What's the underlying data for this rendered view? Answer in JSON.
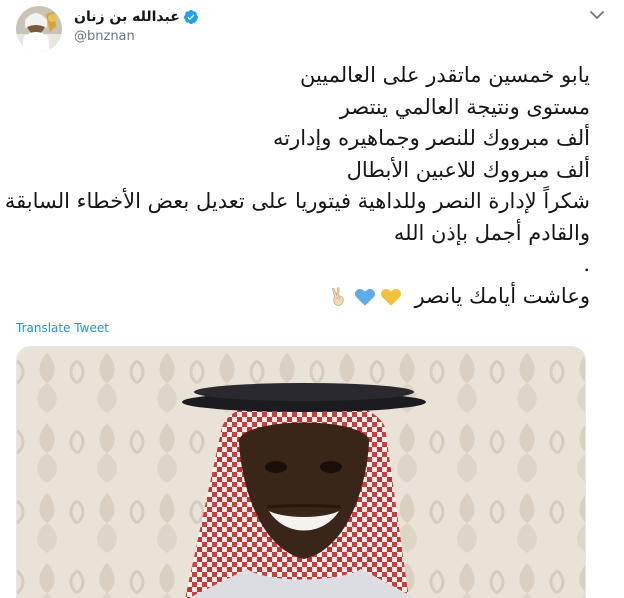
{
  "tweet": {
    "author": {
      "display_name": "عبدالله بن زنان",
      "handle": "@bnznan",
      "verified": true,
      "avatar_icon": "avatar-photo"
    },
    "menu_icon": "chevron-down-icon",
    "lines": [
      "يابو خمسين ماتقدر على العالميين",
      "مستوى ونتيجة العالمي ينتصر",
      "ألف مبرووك للنصر وجماهيره وإدارته",
      "ألف مبرووك للاعبين الأبطال",
      "شكراً لإدارة النصر وللداهية فيتوريا على تعديل بعض الأخطاء السابقة",
      "والقادم أجمل بإذن الله",
      "."
    ],
    "last_line": "وعاشت أيامك يانصر",
    "emojis": [
      "yellow-heart-icon",
      "blue-heart-icon",
      "victory-hand-icon"
    ],
    "translate_label": "Translate Tweet",
    "media": {
      "description_icon": "photo-man-in-shemagh"
    }
  },
  "colors": {
    "link": "#1b95e0",
    "verified": "#1da1f2",
    "text": "#14171a",
    "muted": "#657786",
    "yellow_heart": "#f5c13b",
    "blue_heart": "#5dadec"
  }
}
